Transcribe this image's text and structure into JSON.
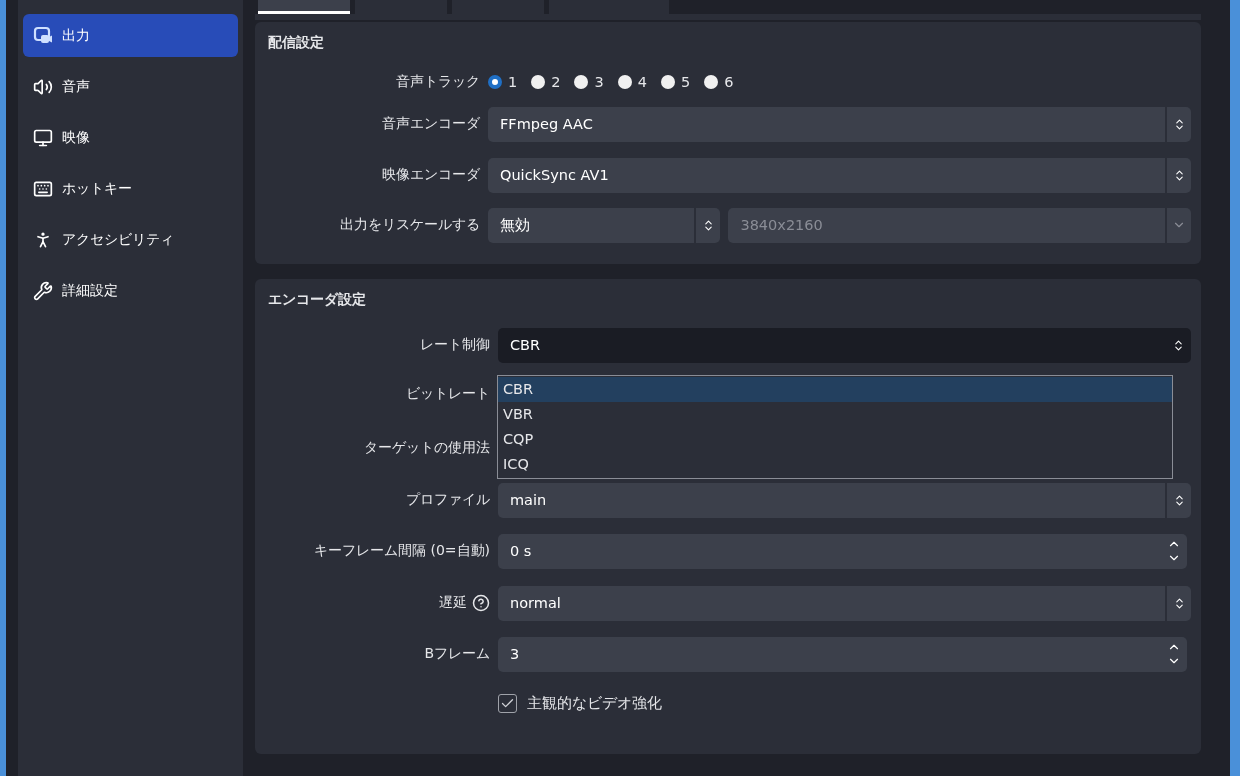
{
  "sidebar": {
    "items": [
      {
        "label": "出力",
        "selected": true
      },
      {
        "label": "音声",
        "selected": false
      },
      {
        "label": "映像",
        "selected": false
      },
      {
        "label": "ホットキー",
        "selected": false
      },
      {
        "label": "アクセシビリティ",
        "selected": false
      },
      {
        "label": "詳細設定",
        "selected": false
      }
    ]
  },
  "tabs": [
    {
      "selected": true
    },
    {
      "selected": false
    },
    {
      "selected": false
    },
    {
      "selected": false
    }
  ],
  "streaming": {
    "title": "配信設定",
    "rows": [
      {
        "kind": "radios",
        "label": "音声トラック",
        "options": [
          {
            "label": "1",
            "selected": true
          },
          {
            "label": "2",
            "selected": false
          },
          {
            "label": "3",
            "selected": false
          },
          {
            "label": "4",
            "selected": false
          },
          {
            "label": "5",
            "selected": false
          },
          {
            "label": "6",
            "selected": false
          }
        ]
      },
      {
        "kind": "select",
        "label": "音声エンコーダ",
        "value": "FFmpeg AAC"
      },
      {
        "kind": "select",
        "label": "映像エンコーダ",
        "value": "QuickSync AV1"
      },
      {
        "kind": "rescale",
        "label": "出力をリスケールする",
        "value": "無効",
        "resolution": "3840x2160",
        "resolution_disabled": true
      }
    ]
  },
  "encoder": {
    "title": "エンコーダ設定",
    "rows": [
      {
        "kind": "select",
        "label": "レート制御",
        "value": "CBR",
        "open": true,
        "options": [
          {
            "label": "CBR",
            "selected": true
          },
          {
            "label": "VBR",
            "selected": false
          },
          {
            "label": "CQP",
            "selected": false
          },
          {
            "label": "ICQ",
            "selected": false
          }
        ]
      },
      {
        "kind": "covered",
        "label": "ビットレート"
      },
      {
        "kind": "covered",
        "label": "ターゲットの使用法"
      },
      {
        "kind": "select",
        "label": "プロファイル",
        "value": "main"
      },
      {
        "kind": "spin",
        "label": "キーフレーム間隔 (0=自動)",
        "value": "0 s"
      },
      {
        "kind": "select",
        "label": "遅延",
        "value": "normal",
        "help": true
      },
      {
        "kind": "spin",
        "label": "Bフレーム",
        "value": "3"
      },
      {
        "kind": "checkbox",
        "label": "主観的なビデオ強化",
        "checked": true
      }
    ]
  }
}
